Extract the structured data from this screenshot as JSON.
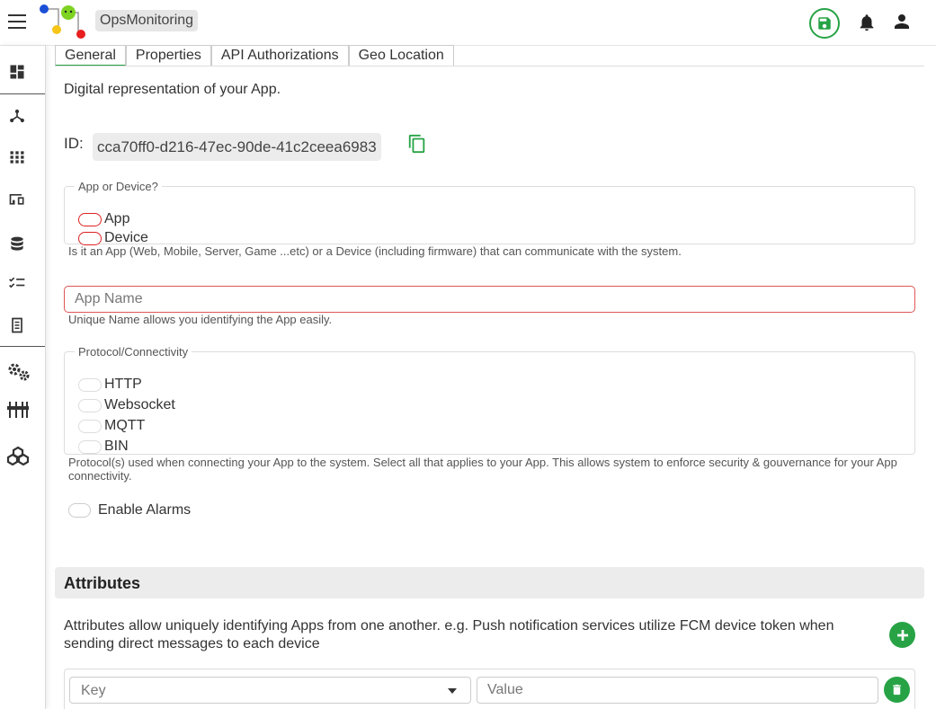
{
  "header": {
    "app_title": "OpsMonitoring",
    "icons": [
      "menu-icon",
      "logo",
      "save-icon",
      "bell-icon",
      "user-icon"
    ]
  },
  "sidebar": {
    "items": [
      {
        "icon": "dashboard-icon"
      },
      {
        "icon": "hub-icon"
      },
      {
        "icon": "apps-grid-icon"
      },
      {
        "icon": "devices-icon"
      },
      {
        "icon": "database-icon"
      },
      {
        "icon": "checklist-icon"
      },
      {
        "icon": "receipt-icon"
      },
      {
        "icon": "settings-gears-icon"
      },
      {
        "icon": "sliders-icon"
      },
      {
        "icon": "cubes-icon"
      }
    ]
  },
  "tabs": [
    {
      "label": "General",
      "active": true
    },
    {
      "label": "Properties",
      "active": false
    },
    {
      "label": "API Authorizations",
      "active": false
    },
    {
      "label": "Geo Location",
      "active": false
    }
  ],
  "main": {
    "description": "Digital representation of your App.",
    "id_label": "ID:",
    "id_value": "cca70ff0-d216-47ec-90de-41c2ceea6983",
    "type_group": {
      "legend": "App or Device?",
      "options": [
        "App",
        "Device"
      ],
      "help": "Is it an App (Web, Mobile, Server, Game ...etc) or a Device (including firmware) that can communicate with the system."
    },
    "app_name": {
      "placeholder": "App Name",
      "value": "",
      "help": "Unique Name allows you identifying the App easily."
    },
    "protocol_group": {
      "legend": "Protocol/Connectivity",
      "options": [
        "HTTP",
        "Websocket",
        "MQTT",
        "BIN"
      ],
      "help": "Protocol(s) used when connecting your App to the system. Select all that applies to your App. This allows system to enforce security & gouvernance for your App connectivity."
    },
    "alarms_label": "Enable Alarms"
  },
  "attributes": {
    "title": "Attributes",
    "description": "Attributes allow uniquely identifying Apps from one another. e.g. Push notification services utilize FCM device token when sending direct messages to each device",
    "key_placeholder": "Key",
    "value_placeholder": "Value"
  },
  "colors": {
    "accent": "#27a345",
    "error": "#d22222"
  }
}
